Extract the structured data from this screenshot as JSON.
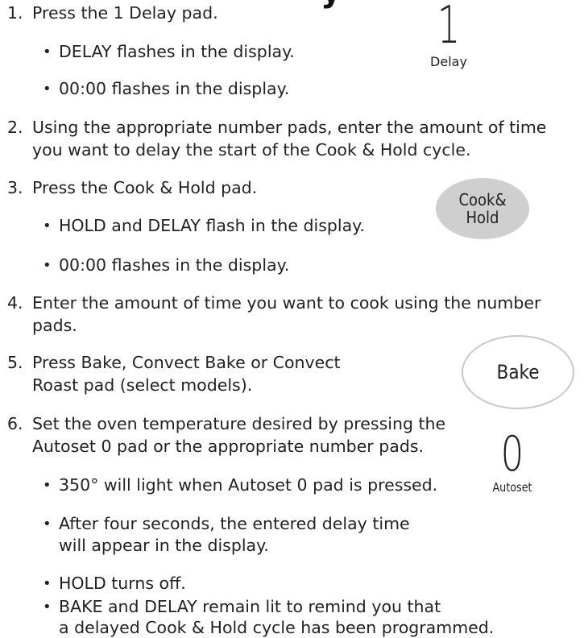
{
  "heading_fragment": "y",
  "steps": [
    {
      "num": "1.",
      "lines": [
        "Press the 1 Delay pad."
      ]
    },
    {
      "num": "2.",
      "lines": [
        "Using the appropriate number pads, enter the amount of time",
        "you want to delay the start of the Cook & Hold cycle."
      ]
    },
    {
      "num": "3.",
      "lines": [
        "Press the Cook & Hold pad."
      ]
    },
    {
      "num": "4.",
      "lines": [
        "Enter the amount of time you want to cook using the number",
        "pads."
      ]
    },
    {
      "num": "5.",
      "lines": [
        "Press Bake, Convect Bake or Convect",
        "Roast pad (select models)."
      ]
    },
    {
      "num": "6.",
      "lines": [
        "Set the oven temperature desired by pressing the",
        "Autoset 0 pad or the appropriate number pads."
      ]
    }
  ],
  "bullets": {
    "step1": [
      "DELAY flashes in the display.",
      "00:00 flashes in the display."
    ],
    "step3": [
      "HOLD and DELAY flash in the display.",
      "00:00 flashes in the display."
    ],
    "step6": [
      [
        "350° will light when Autoset 0 pad is pressed."
      ],
      [
        "After four seconds, the entered delay time",
        "will appear in the display."
      ],
      [
        "HOLD turns off."
      ],
      [
        "BAKE and DELAY remain lit to remind you that",
        "a delayed Cook & Hold cycle has been programmed."
      ]
    ]
  },
  "bullet_char": "•",
  "pads": {
    "delay": {
      "digit": "1",
      "label": "Delay"
    },
    "cook_hold": {
      "line1": "Cook&",
      "line2": "Hold"
    },
    "bake": {
      "label": "Bake"
    },
    "autoset": {
      "digit": "0",
      "label": "Autoset"
    }
  }
}
